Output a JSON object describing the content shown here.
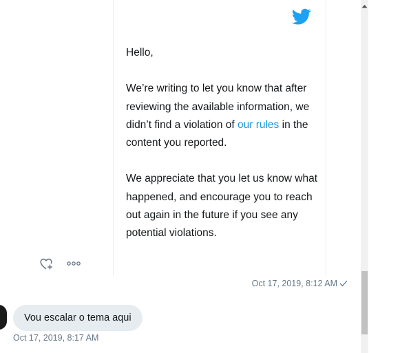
{
  "email": {
    "greeting": "Hello,",
    "paragraph1_before_link": "We’re writing to let you know that after reviewing the available information, we didn’t find a violation of ",
    "link_text": "our rules",
    "paragraph1_after_link": " in the content you reported.",
    "paragraph2": "We appreciate that you let us know what happened, and encourage you to reach out again in the future if you see any potential violations.",
    "timestamp": "Oct 17, 2019, 8:12 AM",
    "brand_icon": "twitter-bird-icon",
    "brand_color": "#1da1f2",
    "link_color": "#1b95e0",
    "status_icon": "checkmark-icon"
  },
  "message_actions": {
    "react_icon": "heart-plus-icon",
    "more_icon": "more-dots-icon"
  },
  "received_message": {
    "text": "Vou escalar o tema aqui",
    "timestamp": "Oct 17, 2019, 8:17 AM",
    "bubble_color": "#e6ecf0"
  },
  "colors": {
    "text": "#14171a",
    "secondary_text": "#657786",
    "scrollbar_track": "#f1f1f1",
    "scrollbar_thumb": "#c1c1c1"
  }
}
